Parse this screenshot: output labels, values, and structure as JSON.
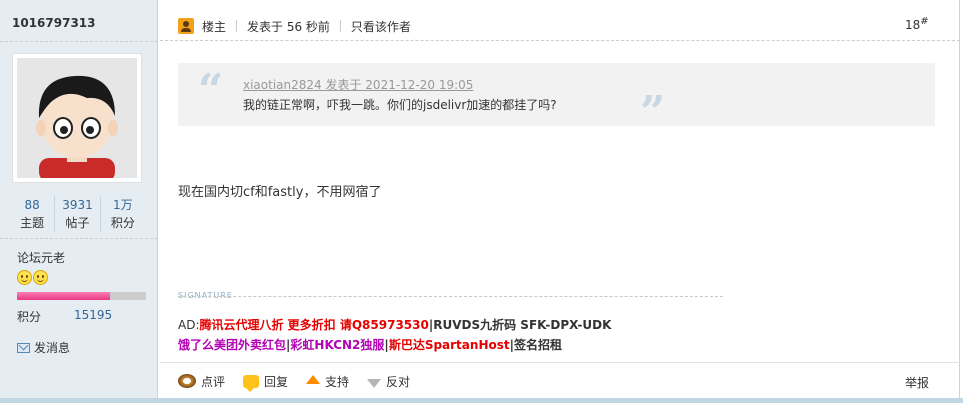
{
  "user": {
    "name": "1016797313",
    "stats": [
      {
        "value": "88",
        "label": "主题"
      },
      {
        "value": "3931",
        "label": "帖子"
      },
      {
        "value": "1万",
        "label": "积分"
      }
    ],
    "group": "论坛元老",
    "credit_progress": 0.72,
    "points_label": "积分",
    "points_value": "15195",
    "message_label": "发消息"
  },
  "post": {
    "owner_label": "楼主",
    "posted": "发表于 56 秒前",
    "author_only": "只看该作者",
    "floor": "18",
    "floor_mark": "#",
    "quote": {
      "header": "xiaotian2824 发表于 2021-12-20 19:05",
      "body": "我的链正常啊，吓我一跳。你们的jsdelivr加速的都挂了吗?"
    },
    "content": "现在国内切cf和fastly，不用网宿了",
    "signature_label": "SIGNATURE",
    "sig": {
      "ad_prefix": "AD:",
      "ad1": "腾讯云代理八折 更多折扣 请Q85973530",
      "sep": "|",
      "ad2": "RUVDS九折码 SFK-DPX-UDK",
      "ad3": "饿了么美团外卖红包",
      "ad4": "彩虹HKCN2独服",
      "ad5": "斯巴达SpartanHost",
      "ad6": "签名招租"
    },
    "actions": {
      "comment": "点评",
      "reply": "回复",
      "support": "支持",
      "oppose": "反对",
      "report": "举报"
    }
  }
}
